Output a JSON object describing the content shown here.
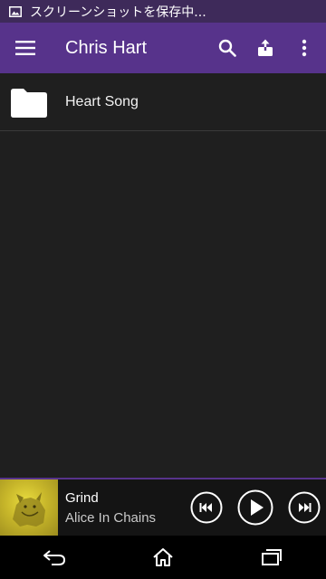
{
  "status_bar": {
    "text": "スクリーンショットを保存中..."
  },
  "app_bar": {
    "title": "Chris Hart"
  },
  "list": {
    "items": [
      {
        "label": "Heart Song",
        "icon": "folder-icon"
      }
    ]
  },
  "now_playing": {
    "title": "Grind",
    "artist": "Alice In Chains"
  },
  "colors": {
    "status_bar": "#3e2a5a",
    "app_bar": "#57338b",
    "background": "#1f1f1f",
    "accent": "#57338b"
  }
}
